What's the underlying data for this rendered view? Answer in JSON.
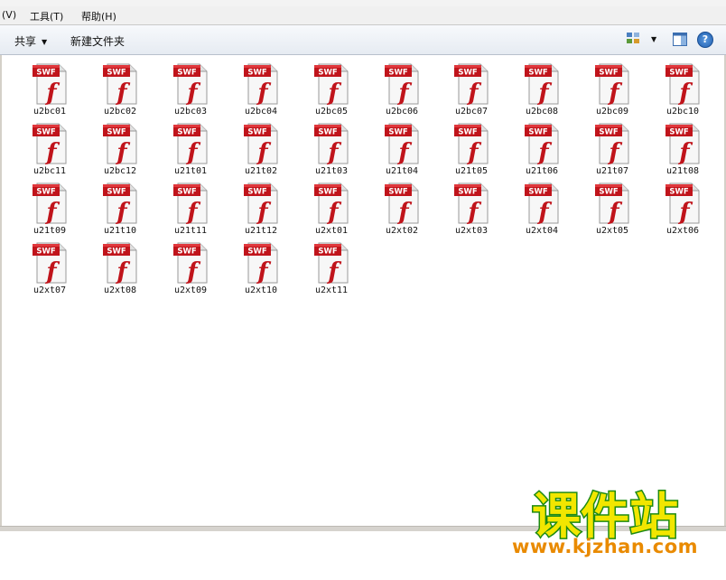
{
  "menubar": {
    "view_partial": "(V)",
    "tools": "工具(T)",
    "help": "帮助(H)"
  },
  "toolbar": {
    "share_label": "共享",
    "new_folder_label": "新建文件夹",
    "view_icon": "view-options-icon",
    "preview_icon": "preview-pane-icon",
    "help_icon": "help-icon",
    "help_glyph": "?"
  },
  "file_icon": {
    "type_label": "SWF",
    "glyph": "f"
  },
  "files": [
    "u2bc01",
    "u2bc02",
    "u2bc03",
    "u2bc04",
    "u2bc05",
    "u2bc06",
    "u2bc07",
    "u2bc08",
    "u2bc09",
    "u2bc10",
    "u2bc11",
    "u2bc12",
    "u21t01",
    "u21t02",
    "u21t03",
    "u21t04",
    "u21t05",
    "u21t06",
    "u21t07",
    "u21t08",
    "u21t09",
    "u21t10",
    "u21t11",
    "u21t12",
    "u2xt01",
    "u2xt02",
    "u2xt03",
    "u2xt04",
    "u2xt05",
    "u2xt06",
    "u2xt07",
    "u2xt08",
    "u2xt09",
    "u2xt10",
    "u2xt11"
  ],
  "watermark": {
    "title": "课件站",
    "url": "www.kjzhan.com"
  },
  "colors": {
    "swf_red": "#c0141b",
    "watermark_yellow": "#f2e600",
    "watermark_green": "#1d8a12",
    "watermark_orange": "#e98a00"
  }
}
